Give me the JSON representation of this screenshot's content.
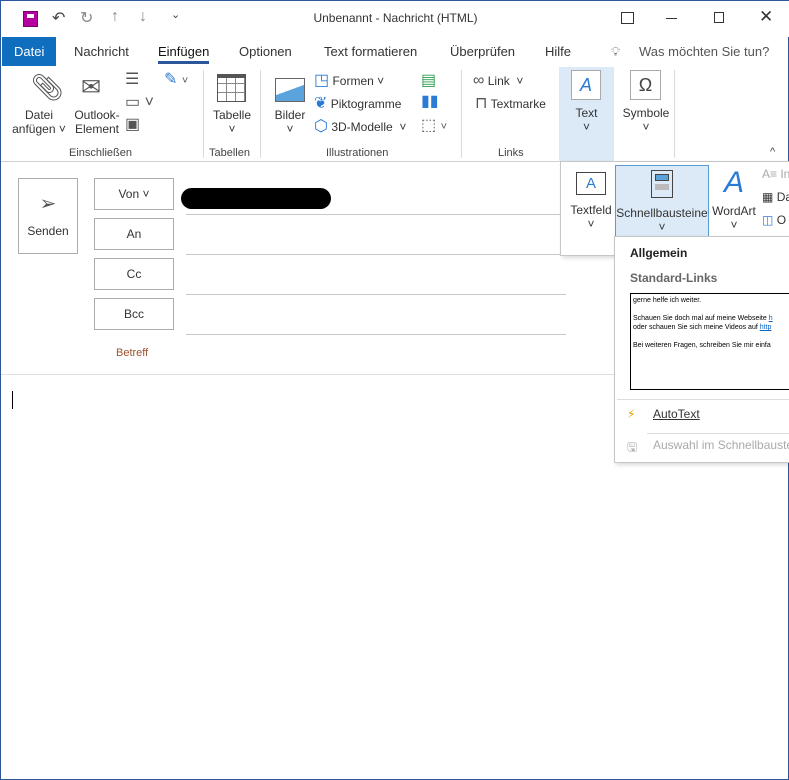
{
  "window": {
    "title": "Unbenannt  -  Nachricht (HTML)",
    "accent": "#2b579a"
  },
  "tabs": [
    {
      "label": "Datei"
    },
    {
      "label": "Nachricht"
    },
    {
      "label": "Einfügen"
    },
    {
      "label": "Optionen"
    },
    {
      "label": "Text formatieren"
    },
    {
      "label": "Überprüfen"
    },
    {
      "label": "Hilfe"
    }
  ],
  "tellme": "Was möchten Sie tun?",
  "ribbon": {
    "attach_1": "Datei",
    "attach_2": "anfügen",
    "outlook_1": "Outlook-",
    "outlook_2": "Element",
    "table": "Tabelle",
    "pictures": "Bilder",
    "shapes": "Formen",
    "icons": "Piktogramme",
    "models3d": "3D-Modelle",
    "link": "Link",
    "bookmark": "Textmarke",
    "text": "Text",
    "symbols": "Symbole",
    "groups": {
      "include": "Einschließen",
      "tables": "Tabellen",
      "illustrations": "Illustrationen",
      "links": "Links"
    }
  },
  "compose": {
    "send": "Senden",
    "from": "Von",
    "to": "An",
    "cc": "Cc",
    "bcc": "Bcc",
    "subject": "Betreff"
  },
  "text_panel": {
    "textbox": "Textfeld",
    "quickparts": "Schnellbausteine",
    "wordart": "WordArt",
    "s1": "In",
    "s2": "Da",
    "s3": "O"
  },
  "quickparts_menu": {
    "category": "Allgemein",
    "entry": "Standard-Links",
    "preview": {
      "l1": "gerne helfe ich weiter.",
      "l2": "Schauen Sie doch mal auf meine Webseite ",
      "l2link": "h",
      "l3": "oder schauen Sie sich meine Videos auf ",
      "l3link": "http",
      "l4": "Bei weiteren Fragen, schreiben Sie mir einfa"
    },
    "autotext": "AutoText",
    "save_selection": "Auswahl im Schnellbauste"
  }
}
